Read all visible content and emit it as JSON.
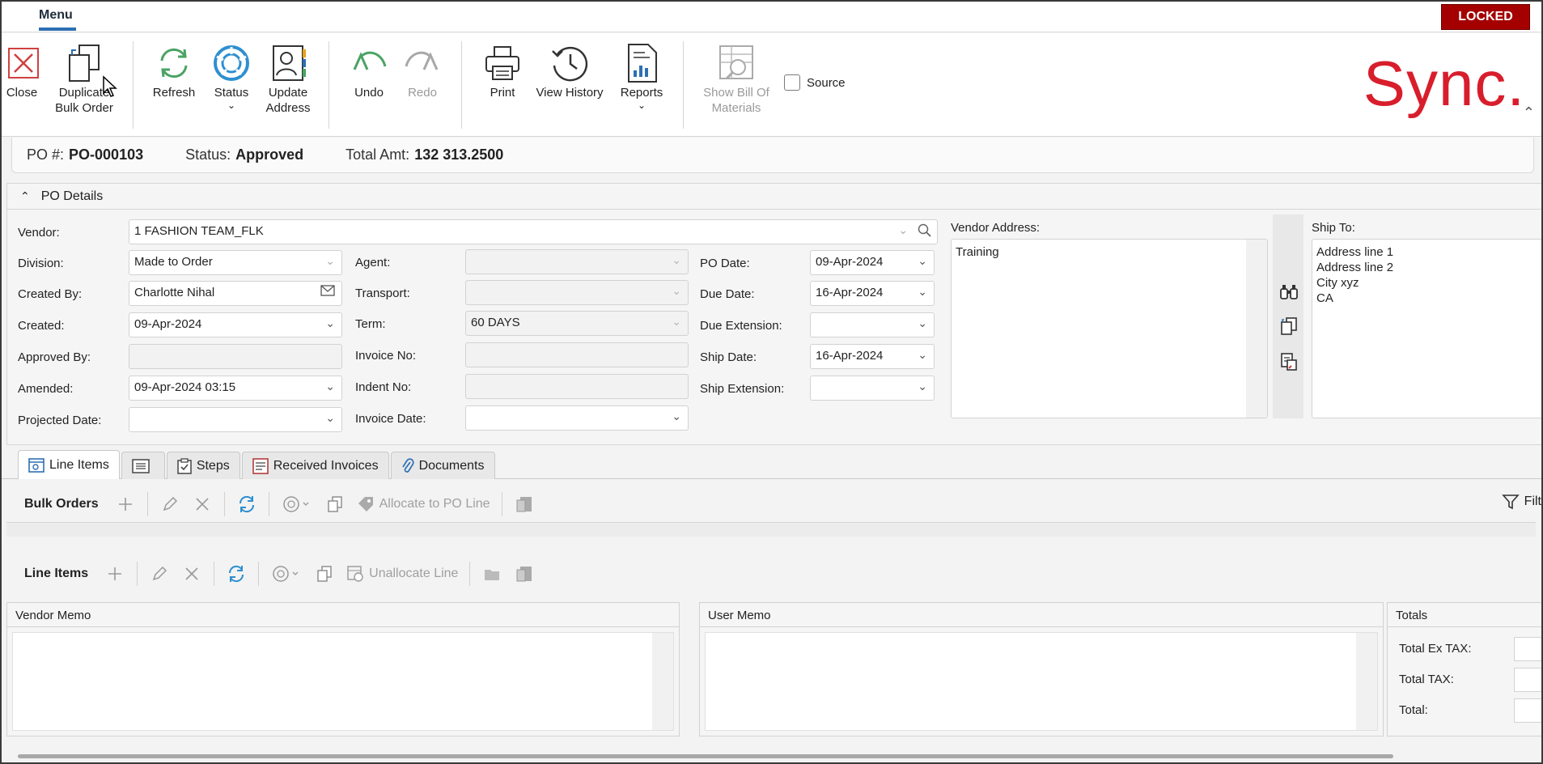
{
  "menubar": {
    "menu_tab": "Menu",
    "locked_badge": "LOCKED"
  },
  "ribbon": {
    "close": "Close",
    "duplicate_line1": "Duplicate",
    "duplicate_line2": "Bulk Order",
    "refresh": "Refresh",
    "status": "Status",
    "update_line1": "Update",
    "update_line2": "Address",
    "undo": "Undo",
    "redo": "Redo",
    "print": "Print",
    "view_history": "View History",
    "reports": "Reports",
    "show_bom_line1": "Show Bill Of",
    "show_bom_line2": "Materials",
    "source_label": "Source",
    "brand": "Sync."
  },
  "summary": {
    "po_label": "PO #:",
    "po_value": "PO-000103",
    "status_label": "Status:",
    "status_value": "Approved",
    "total_label": "Total Amt:",
    "total_value": "132 313.2500"
  },
  "details": {
    "header": "PO Details",
    "vendor_label": "Vendor:",
    "vendor_value": "1 FASHION TEAM_FLK",
    "division_label": "Division:",
    "division_value": "Made to Order",
    "created_by_label": "Created By:",
    "created_by_value": "Charlotte Nihal",
    "created_label": "Created:",
    "created_value": "09-Apr-2024",
    "approved_by_label": "Approved By:",
    "approved_by_value": "",
    "amended_label": "Amended:",
    "amended_value": "09-Apr-2024  03:15",
    "projected_label": "Projected Date:",
    "projected_value": "",
    "agent_label": "Agent:",
    "agent_value": "",
    "transport_label": "Transport:",
    "transport_value": "",
    "term_label": "Term:",
    "term_value": "60 DAYS",
    "invoice_no_label": "Invoice No:",
    "invoice_no_value": "",
    "indent_no_label": "Indent No:",
    "indent_no_value": "",
    "invoice_date_label": "Invoice Date:",
    "invoice_date_value": "",
    "po_date_label": "PO Date:",
    "po_date_value": "09-Apr-2024",
    "due_date_label": "Due Date:",
    "due_date_value": "16-Apr-2024",
    "due_ext_label": "Due Extension:",
    "due_ext_value": "",
    "ship_date_label": "Ship Date:",
    "ship_date_value": "16-Apr-2024",
    "ship_ext_label": "Ship Extension:",
    "ship_ext_value": "",
    "vendor_address_label": "Vendor Address:",
    "vendor_address_value": "Training",
    "ship_to_label": "Ship To:",
    "ship_to_lines": [
      "Address line 1",
      "Address line 2",
      "City xyz",
      "CA"
    ]
  },
  "tabs": [
    "Line Items",
    "",
    "Steps",
    "Received Invoices",
    "Documents"
  ],
  "bulk_toolbar": {
    "title": "Bulk Orders",
    "allocate": "Allocate to PO Line",
    "filter": "Filt"
  },
  "line_toolbar": {
    "title": "Line Items",
    "unallocate": "Unallocate Line"
  },
  "bottom": {
    "vendor_memo": "Vendor Memo",
    "user_memo": "User Memo",
    "totals": "Totals",
    "total_ex_tax": "Total Ex TAX:",
    "total_tax": "Total TAX:",
    "total": "Total:"
  },
  "colors": {
    "brand": "#d81e2c",
    "locked": "#a40000",
    "accent": "#2d6fb3"
  }
}
